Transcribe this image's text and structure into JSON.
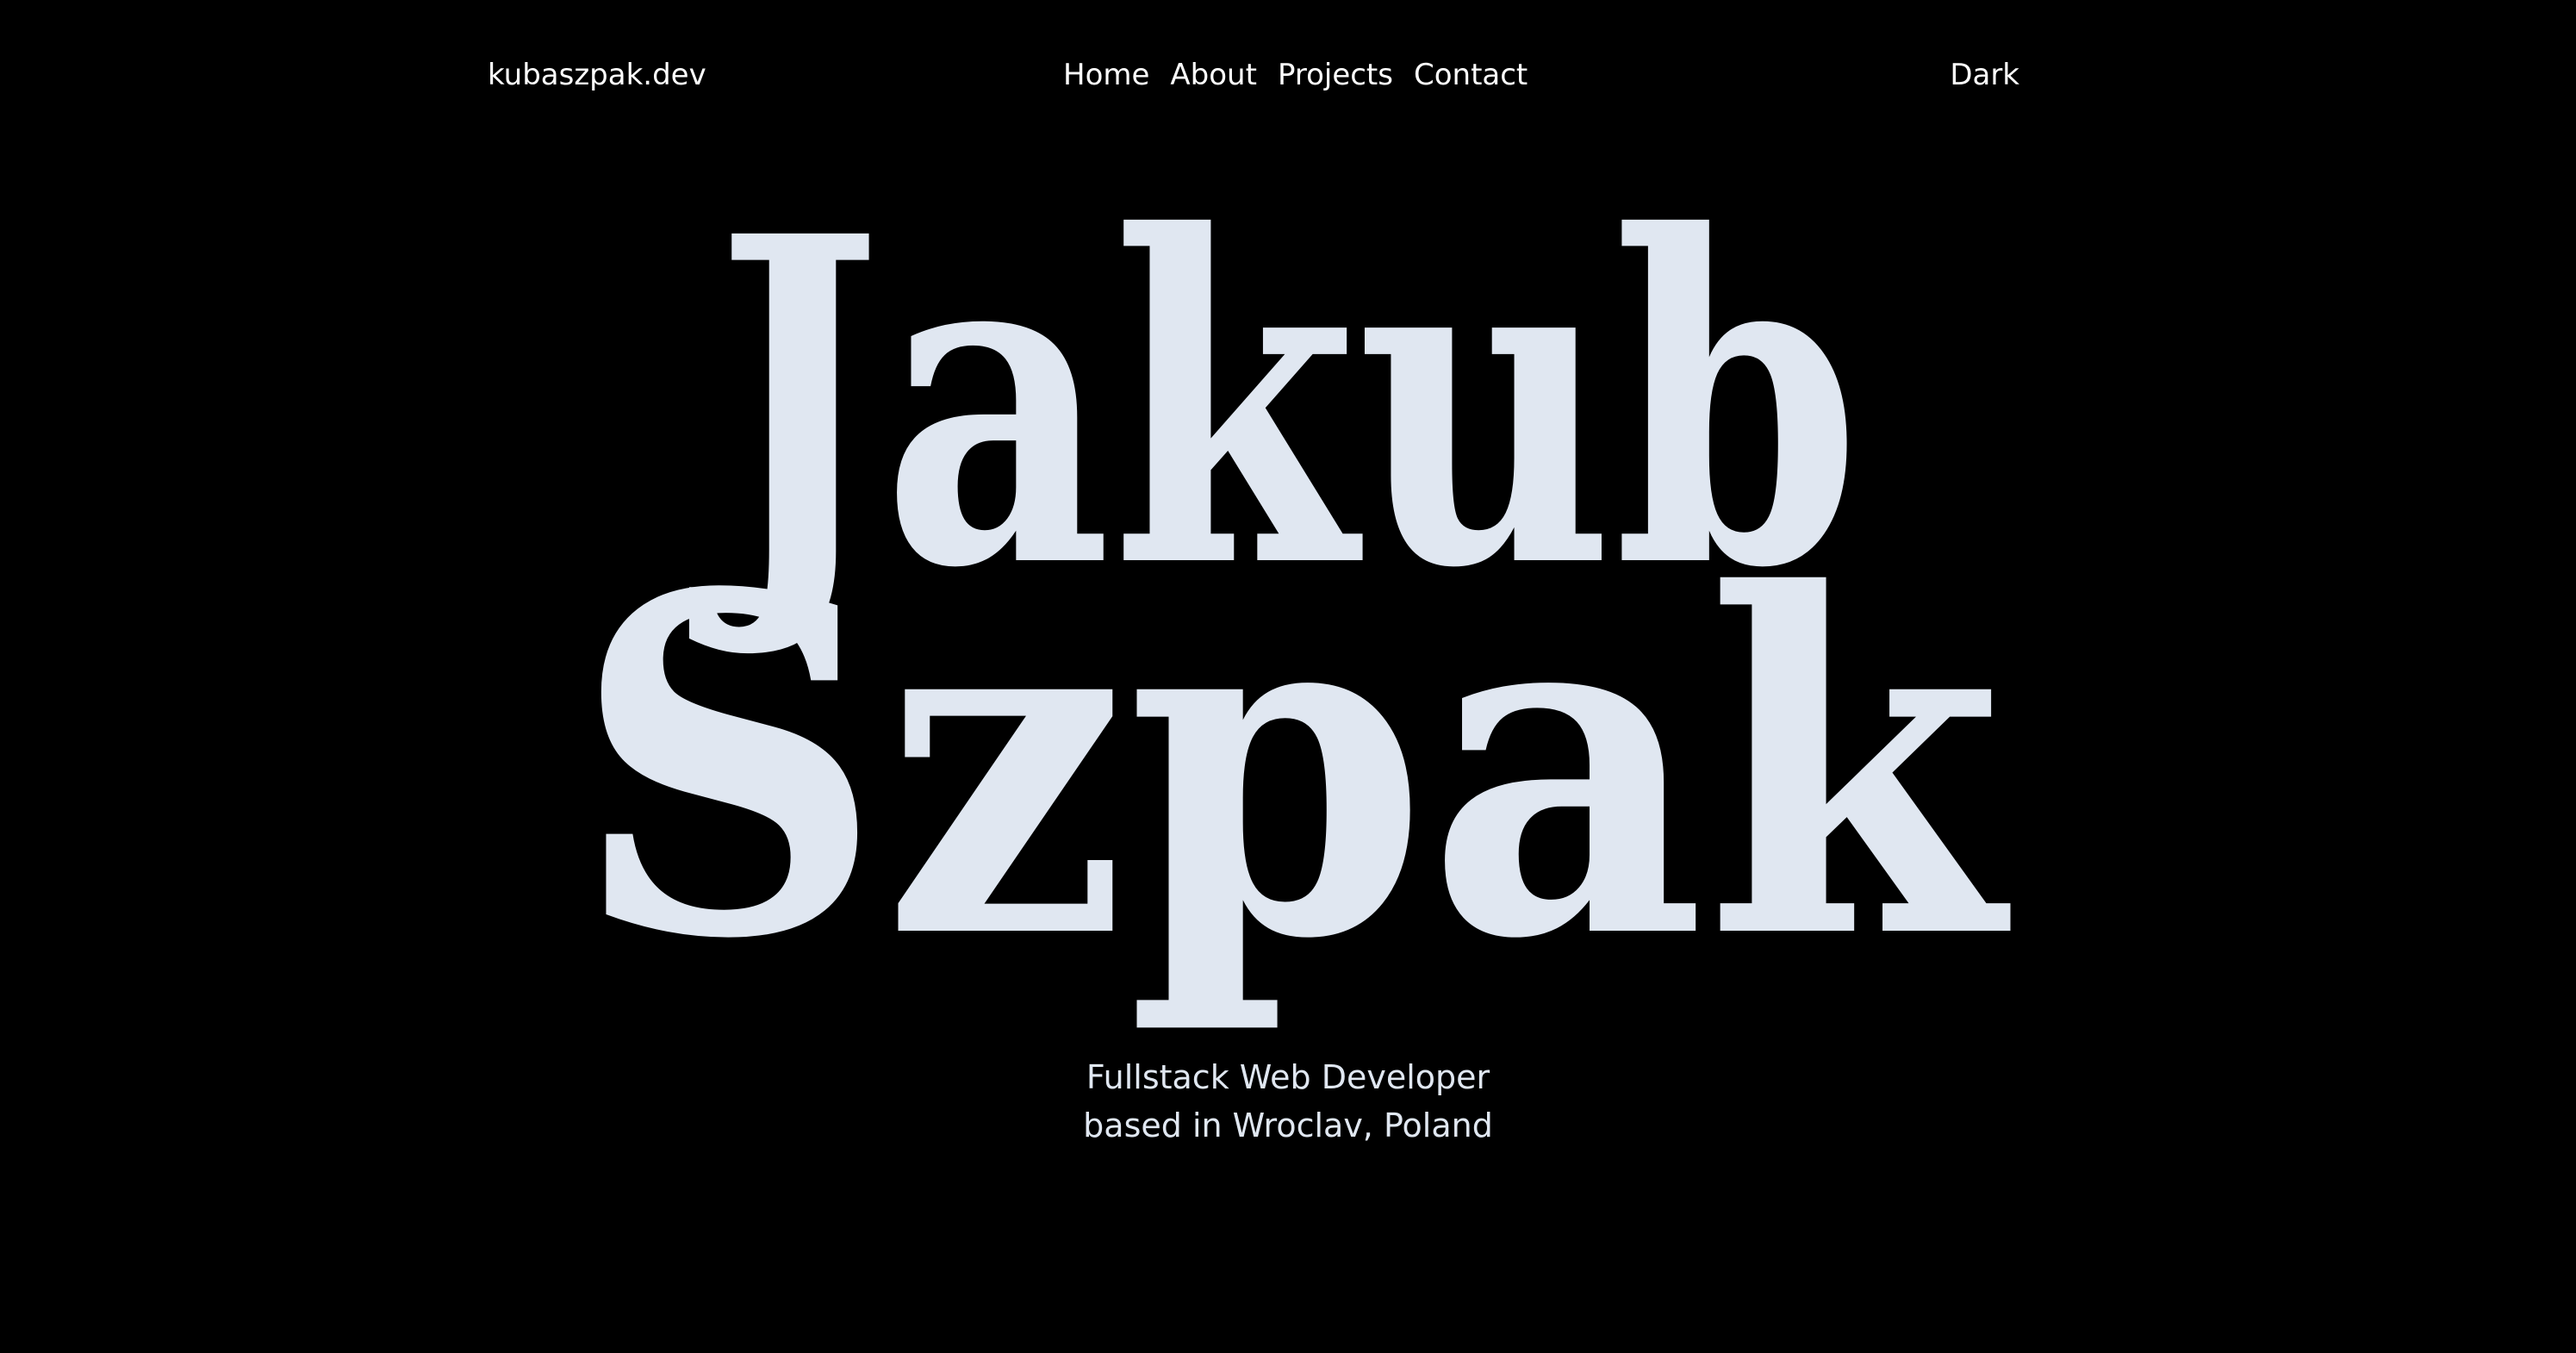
{
  "nav": {
    "logo": "kubaszpak.dev",
    "menu": [
      "Home",
      "About",
      "Projects",
      "Contact"
    ],
    "theme_toggle": "Dark"
  },
  "hero": {
    "first_name": "Jakub",
    "last_name": "Szpak",
    "tagline_line1": "Fullstack Web Developer",
    "tagline_line2": "based in Wroclav, Poland"
  },
  "colors": {
    "background": "#000000",
    "nav_text": "#ffffff",
    "hero_text": "#e0e7f1"
  }
}
